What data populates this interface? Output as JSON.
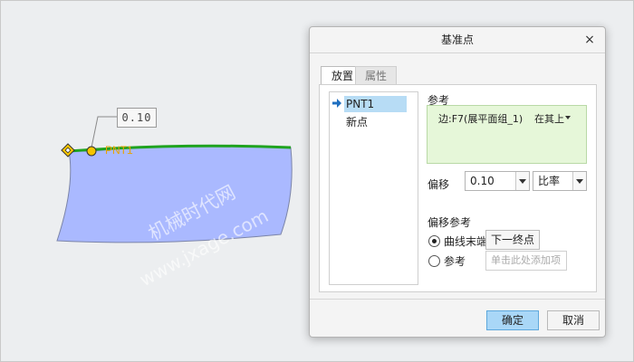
{
  "viewport": {
    "dimension_value": "0.10",
    "point_label": "PNT1",
    "watermark_cn": "机械时代网",
    "watermark_url": "www.jxage.com",
    "colors": {
      "surface": "#aab9ff",
      "edge": "#1fa31f",
      "point": "#f5c400"
    }
  },
  "dialog": {
    "title": "基准点",
    "close_glyph": "×",
    "tabs": [
      {
        "label": "放置",
        "active": true
      },
      {
        "label": "属性",
        "active": false
      }
    ],
    "points": [
      {
        "label": "PNT1",
        "selected": true
      },
      {
        "label": "新点",
        "selected": false
      }
    ],
    "references": {
      "label": "参考",
      "item": "边:F7(展平面组_1)",
      "constraint": "在其上"
    },
    "offset": {
      "label": "偏移",
      "value": "0.10",
      "type": "比率"
    },
    "offset_reference": {
      "label": "偏移参考",
      "options": [
        {
          "label": "曲线末端",
          "checked": true,
          "button": "下一终点"
        },
        {
          "label": "参考",
          "checked": false,
          "placeholder": "单击此处添加项"
        }
      ]
    },
    "buttons": {
      "ok": "确定",
      "cancel": "取消"
    }
  }
}
